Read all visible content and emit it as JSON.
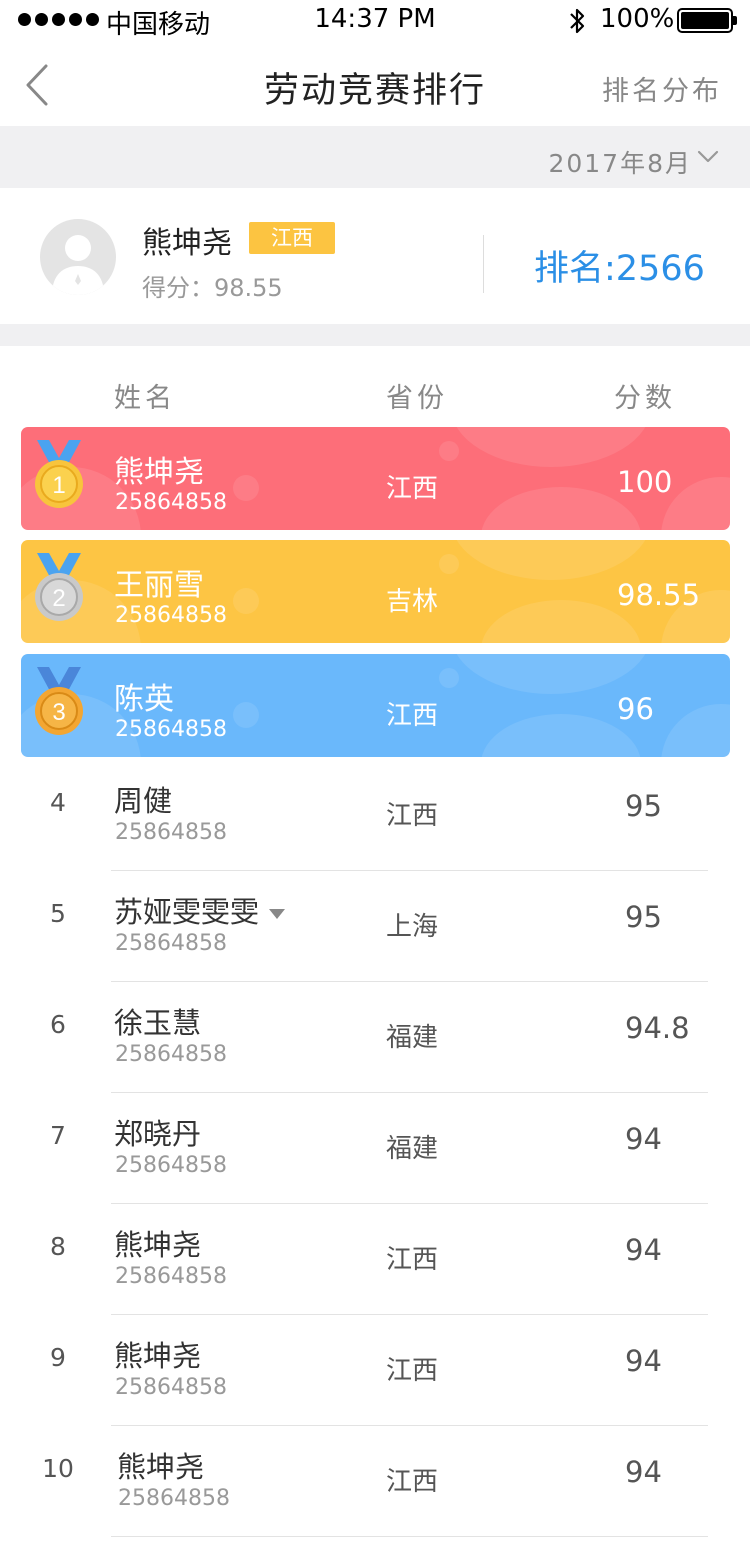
{
  "status_bar": {
    "carrier": "中国移动",
    "time": "14:37 PM",
    "battery": "100%"
  },
  "nav": {
    "title": "劳动竞赛排行",
    "right_label": "排名分布"
  },
  "filter": {
    "date": "2017年8月"
  },
  "me": {
    "name": "熊坤尧",
    "province": "江西",
    "score": "得分：98.55",
    "rank": "排名:2566"
  },
  "table": {
    "headers": {
      "name": "姓名",
      "province": "省份",
      "score": "分数"
    },
    "top_rows": [
      {
        "medal": "1",
        "name": "熊坤尧",
        "uid": "25864858",
        "province": "江西",
        "score": "100",
        "color": "#fd6e79"
      },
      {
        "medal": "2",
        "name": "王丽雪",
        "uid": "25864858",
        "province": "吉林",
        "score": "98.55",
        "color": "#fdc544"
      },
      {
        "medal": "3",
        "name": "陈英",
        "uid": "25864858",
        "province": "江西",
        "score": "96",
        "color": "#6ab8fb"
      }
    ],
    "rows": [
      {
        "rank": "4",
        "name": "周健",
        "uid": "25864858",
        "province": "江西",
        "score": "95"
      },
      {
        "rank": "5",
        "name": "苏娅雯雯雯",
        "uid": "25864858",
        "province": "上海",
        "score": "95"
      },
      {
        "rank": "6",
        "name": "徐玉慧",
        "uid": "25864858",
        "province": "福建",
        "score": "94.8"
      },
      {
        "rank": "7",
        "name": "郑晓丹",
        "uid": "25864858",
        "province": "福建",
        "score": "94"
      },
      {
        "rank": "8",
        "name": "熊坤尧",
        "uid": "25864858",
        "province": "江西",
        "score": "94"
      },
      {
        "rank": "9",
        "name": "熊坤尧",
        "uid": "25864858",
        "province": "江西",
        "score": "94"
      },
      {
        "rank": "10",
        "name": "熊坤尧",
        "uid": "25864858",
        "province": "江西",
        "score": "94"
      }
    ]
  },
  "icons": {
    "back": "chevron-left-icon",
    "date_dropdown": "chevron-down-icon",
    "bluetooth": "bluetooth-icon",
    "medal": "medal-icon",
    "avatar": "default-avatar-icon"
  },
  "colors": {
    "accent": "#2b8fe6",
    "tag": "#fcc441",
    "gold": "#fd6e79",
    "silver": "#fdc544",
    "bronze": "#6ab8fb"
  }
}
